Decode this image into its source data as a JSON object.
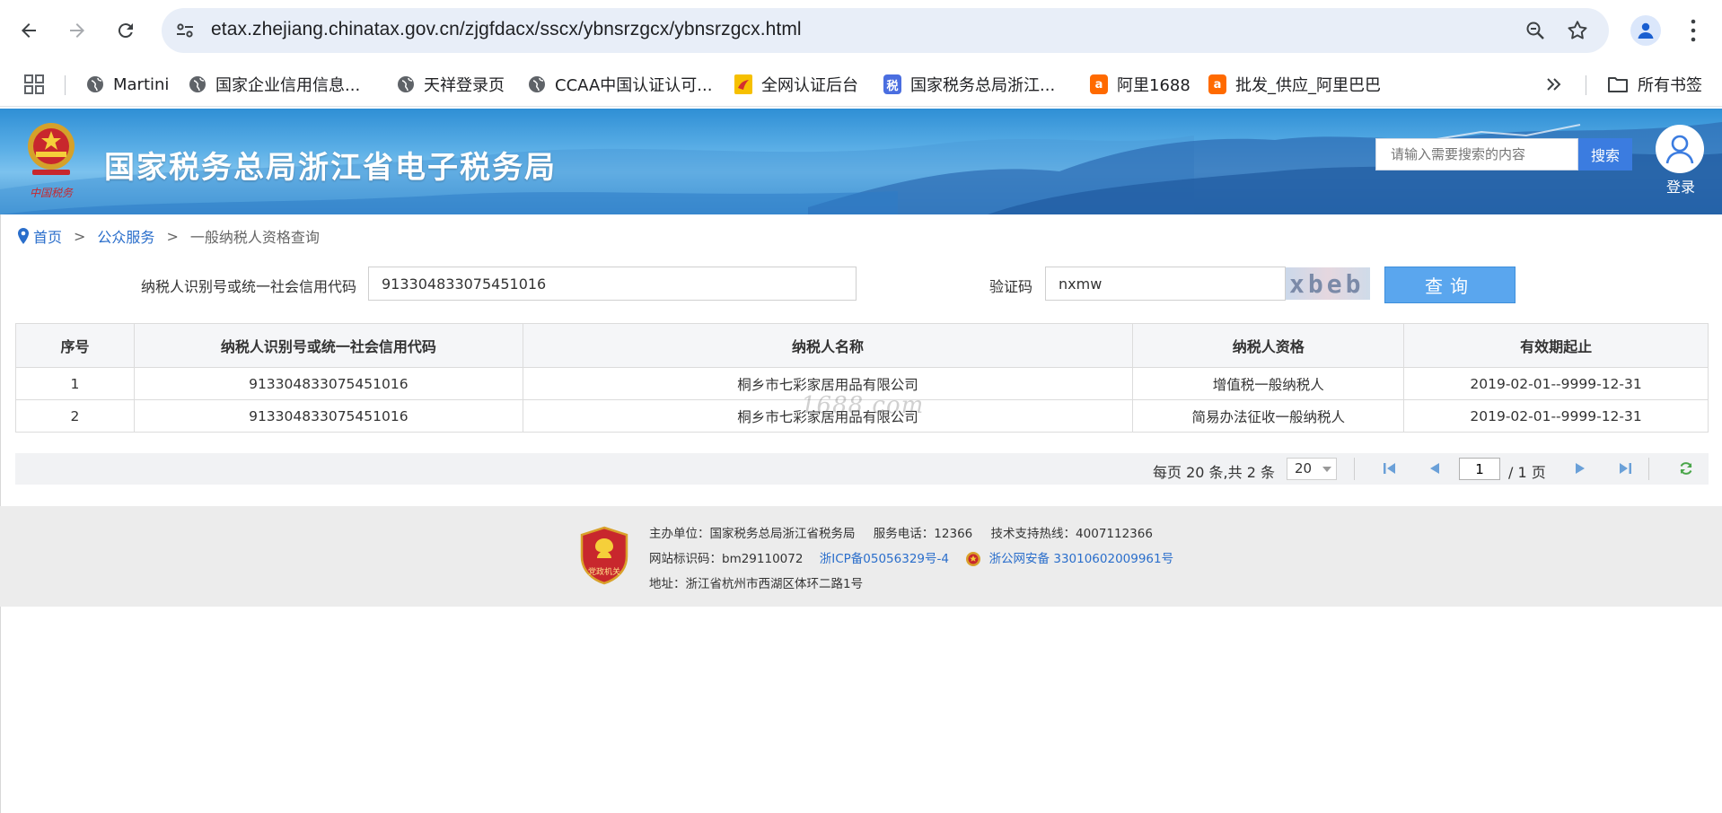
{
  "browser": {
    "url": "etax.zhejiang.chinatax.gov.cn/zjgfdacx/sscx/ybnsrzgcx/ybnsrzgcx.html",
    "bookmarks": [
      {
        "label": "Martini",
        "icon": "globe-icon"
      },
      {
        "label": "国家企业信用信息...",
        "icon": "globe-icon"
      },
      {
        "label": "天祥登录页",
        "icon": "globe-icon"
      },
      {
        "label": "CCAA中国认证认可...",
        "icon": "globe-icon"
      },
      {
        "label": "全网认证后台",
        "icon": "qc-icon"
      },
      {
        "label": "国家税务总局浙江...",
        "icon": "tax-icon"
      },
      {
        "label": "阿里1688",
        "icon": "alibaba-icon"
      },
      {
        "label": "批发_供应_阿里巴巴",
        "icon": "alibaba-icon"
      }
    ],
    "all_bookmarks": "所有书签",
    "tax_favicon_char": "税",
    "ali_favicon_char": "a"
  },
  "header": {
    "title": "国家税务总局浙江省电子税务局",
    "emblem_text": "中国税务",
    "search_placeholder": "请输入需要搜索的内容",
    "search_button": "搜索",
    "login": "登录"
  },
  "breadcrumb": {
    "home": "首页",
    "level2": "公众服务",
    "current": "一般纳税人资格查询",
    "separator": ">"
  },
  "form": {
    "taxid_label": "纳税人识别号或统一社会信用代码",
    "taxid_value": "913304833075451016",
    "captcha_label": "验证码",
    "captcha_value": "nxmw",
    "captcha_image_text": "xbeb",
    "query_button": "查询"
  },
  "table": {
    "headers": [
      "序号",
      "纳税人识别号或统一社会信用代码",
      "纳税人名称",
      "纳税人资格",
      "有效期起止"
    ],
    "rows": [
      [
        "1",
        "913304833075451016",
        "桐乡市七彩家居用品有限公司",
        "增值税一般纳税人",
        "2019-02-01--9999-12-31"
      ],
      [
        "2",
        "913304833075451016",
        "桐乡市七彩家居用品有限公司",
        "简易办法征收一般纳税人",
        "2019-02-01--9999-12-31"
      ]
    ],
    "watermark": "1688.com"
  },
  "pager": {
    "total_text": "每页 20 条,共 2 条",
    "page_size": "20",
    "current_page": "1",
    "total_pages_text": "/ 1 页"
  },
  "footer": {
    "badge_text": "党政机关",
    "host": "主办单位：国家税务总局浙江省税务局",
    "phone": "服务电话：12366",
    "support": "技术支持热线：4007112366",
    "site_id": "网站标识码：bm29110072",
    "icp": "浙ICP备05056329号-4",
    "police": "浙公网安备 33010602009961号",
    "address": "地址：浙江省杭州市西湖区体环二路1号"
  },
  "colors": {
    "link": "#2a6ecb",
    "query_button": "#5aa6ee",
    "search_button": "#3b7ce0",
    "footer_bg": "#ececec"
  }
}
